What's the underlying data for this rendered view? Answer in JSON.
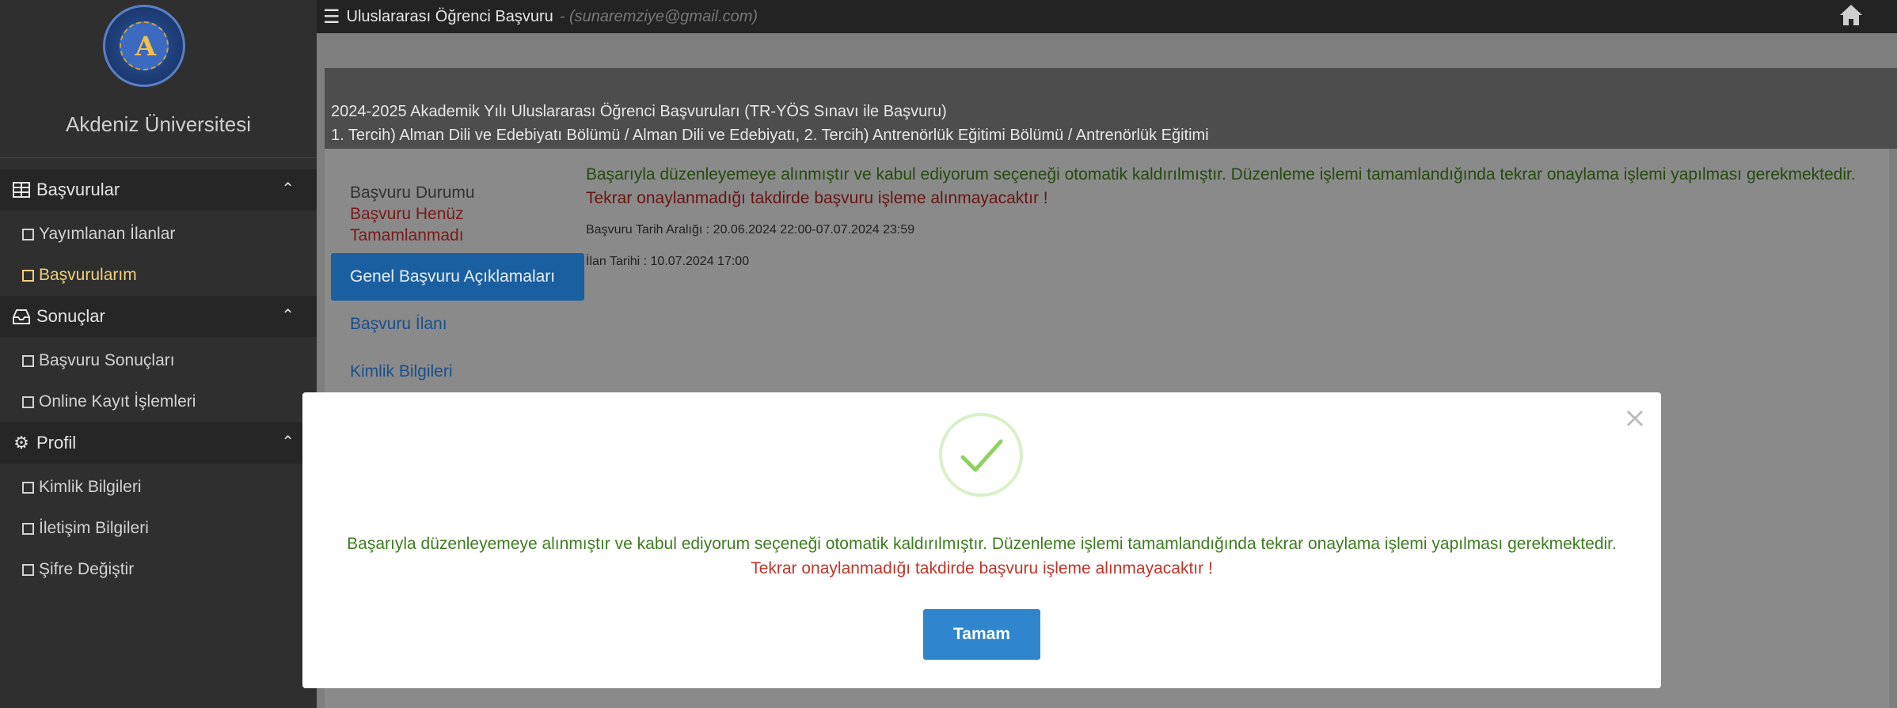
{
  "app": {
    "university_name": "Akdeniz Üniversitesi",
    "title": "Uluslararası Öğrenci Başvuru",
    "email": "- (sunaremziye@gmail.com)"
  },
  "sidebar": {
    "groups": [
      {
        "label": "Başvurular",
        "icon": "folder-icon"
      },
      {
        "label": "Sonuçlar",
        "icon": "inbox-icon"
      },
      {
        "label": "Profil",
        "icon": "cogs-icon"
      }
    ],
    "items": [
      {
        "label": "Yayımlanan İlanlar"
      },
      {
        "label": "Başvurularım"
      },
      {
        "label": "Başvuru Sonuçları"
      },
      {
        "label": "Online Kayıt İşlemleri"
      },
      {
        "label": "Kimlik Bilgileri"
      },
      {
        "label": "İletişim Bilgileri"
      },
      {
        "label": "Şifre Değiştir"
      }
    ]
  },
  "application": {
    "header_line1": "2024-2025 Akademik Yılı Uluslararası Öğrenci Başvuruları (TR-YÖS Sınavı ile Başvuru)",
    "header_line2": "1. Tercih) Alman Dili ve Edebiyatı Bölümü / Alman Dili ve Edebiyatı, 2. Tercih) Antrenörlük Eğitimi Bölümü / Antrenörlük Eğitimi",
    "status_label": "Başvuru Durumu",
    "status_value": "Başvuru Henüz Tamamlanmadı",
    "tabs": [
      "Genel Başvuru Açıklamaları",
      "Başvuru İlanı",
      "Kimlik Bilgileri"
    ],
    "info_success": "Başarıyla düzenleyemeye alınmıştır ve kabul ediyorum seçeneği otomatik kaldırılmıştır. Düzenleme işlemi tamamlandığında tekrar onaylama işlemi yapılması gerekmektedir.",
    "info_warning": "Tekrar onaylanmadığı takdirde başvuru işleme alınmayacaktır !",
    "date_range": "Başvuru Tarih Aralığı : 20.06.2024 22:00-07.07.2024 23:59",
    "announce_date": "İlan Tarihi : 10.07.2024 17:00"
  },
  "modal": {
    "message_success": "Başarıyla düzenleyemeye alınmıştır ve kabul ediyorum seçeneği otomatik kaldırılmıştır. Düzenleme işlemi tamamlandığında tekrar onaylama işlemi yapılması gerekmektedir.",
    "message_warning": "Tekrar onaylanmadığı takdirde başvuru işleme alınmayacaktır !",
    "button_label": "Tamam",
    "close_glyph": "×",
    "icon": "check-icon"
  },
  "colors": {
    "success": "#3c7d1f",
    "warning": "#c1342a",
    "primary": "#2f86cf",
    "active_menu": "#f2d07a"
  }
}
